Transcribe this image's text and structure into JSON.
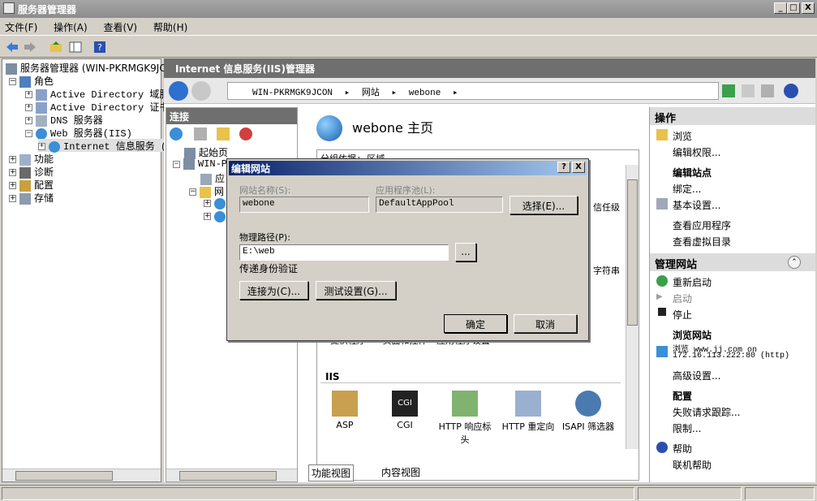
{
  "window": {
    "title": "服务器管理器",
    "min": "_",
    "max": "□",
    "close": "X"
  },
  "menu": [
    "文件(F)",
    "操作(A)",
    "查看(V)",
    "帮助(H)"
  ],
  "tree": {
    "root": "服务器管理器 (WIN-PKRMGK9JCON",
    "roles": "角色",
    "ad_domain": "Active Directory 域服务",
    "ad_cert": "Active Directory 证书服",
    "dns": "DNS 服务器",
    "web": "Web 服务器(IIS)",
    "iis_mgr": "Internet 信息服务 (I",
    "features": "功能",
    "diagnostics": "诊断",
    "config": "配置",
    "storage": "存储"
  },
  "iis": {
    "header": "Internet 信息服务(IIS)管理器",
    "breadcrumb": [
      "WIN-PKRMGK9JCON",
      "网站",
      "webone"
    ],
    "conn_header": "连接",
    "conn_tree": {
      "start": "起始页",
      "server": "WIN-PI",
      "app": "应",
      "sites": "网"
    },
    "home_title": "webone 主页",
    "group_label": "分组依据: 区域",
    "features_row1": [
      {
        "label": "提供程序"
      },
      {
        "label": "页面和控件"
      },
      {
        "label": "应用程序设置"
      }
    ],
    "section_iis": "IIS",
    "features_iis": [
      {
        "label": "ASP"
      },
      {
        "label": "CGI"
      },
      {
        "label": "HTTP 响应标头"
      },
      {
        "label": "HTTP 重定向"
      },
      {
        "label": "ISAPI 筛选器"
      }
    ],
    "partial_labels": {
      "trust": "信任级",
      "conn_str": "字符串"
    },
    "tabs": {
      "features": "功能视图",
      "content": "内容视图"
    }
  },
  "actions": {
    "header": "操作",
    "browse": "浏览",
    "edit_perm": "编辑权限...",
    "edit_site_hdr": "编辑站点",
    "bindings": "绑定...",
    "basic_settings": "基本设置...",
    "view_apps": "查看应用程序",
    "view_vdirs": "查看虚拟目录",
    "manage_hdr": "管理网站",
    "restart": "重新启动",
    "start": "启动",
    "stop": "停止",
    "browse_hdr": "浏览网站",
    "browse_link1": "浏览 www.jj.com on",
    "browse_link2": "172.16.113.222:80 (http)",
    "advanced": "高级设置...",
    "config_hdr": "配置",
    "failed_req": "失败请求跟踪...",
    "limits": "限制...",
    "help": "帮助",
    "online_help": "联机帮助"
  },
  "dialog": {
    "title": "编辑网站",
    "help_btn": "?",
    "close_btn": "X",
    "site_name_label": "网站名称(S):",
    "site_name_value": "webone",
    "app_pool_label": "应用程序池(L):",
    "app_pool_value": "DefaultAppPool",
    "select_btn": "选择(E)...",
    "path_label": "物理路径(P):",
    "path_value": "E:\\web",
    "browse_btn": "...",
    "auth_label": "传递身份验证",
    "connect_as_btn": "连接为(C)...",
    "test_btn": "测试设置(G)...",
    "ok_btn": "确定",
    "cancel_btn": "取消"
  }
}
